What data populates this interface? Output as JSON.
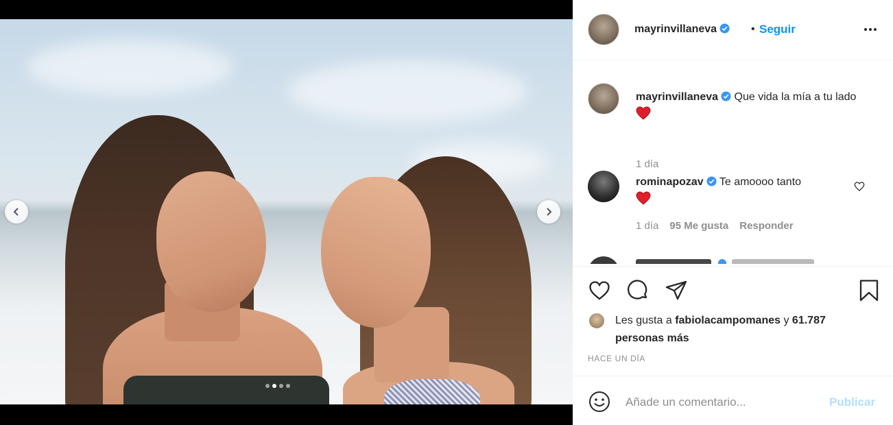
{
  "post": {
    "username": "mayrinvillaneva",
    "follow_label": "Seguir",
    "separator": "•",
    "caption_user": "mayrinvillaneva",
    "caption_text": "Que vida la mía a tu lado",
    "caption_time": "1 día",
    "carousel": {
      "total": 4,
      "active_index": 2
    }
  },
  "comments": [
    {
      "username": "rominapozav",
      "text": "Te amoooo tanto",
      "time": "1 día",
      "likes": "95 Me gusta",
      "reply_label": "Responder"
    }
  ],
  "likes": {
    "prefix": "Les gusta a",
    "first_user": "fabiolacampomanes",
    "joiner": "y",
    "count_text": "61.787 personas más",
    "time_caps": "HACE UN DÍA"
  },
  "add_comment": {
    "placeholder": "Añade un comentario...",
    "publish_label": "Publicar"
  },
  "colors": {
    "accent": "#0095f6",
    "publish_disabled": "#b2dffc",
    "verified": "#3897f0",
    "heart": "#ed4956"
  }
}
